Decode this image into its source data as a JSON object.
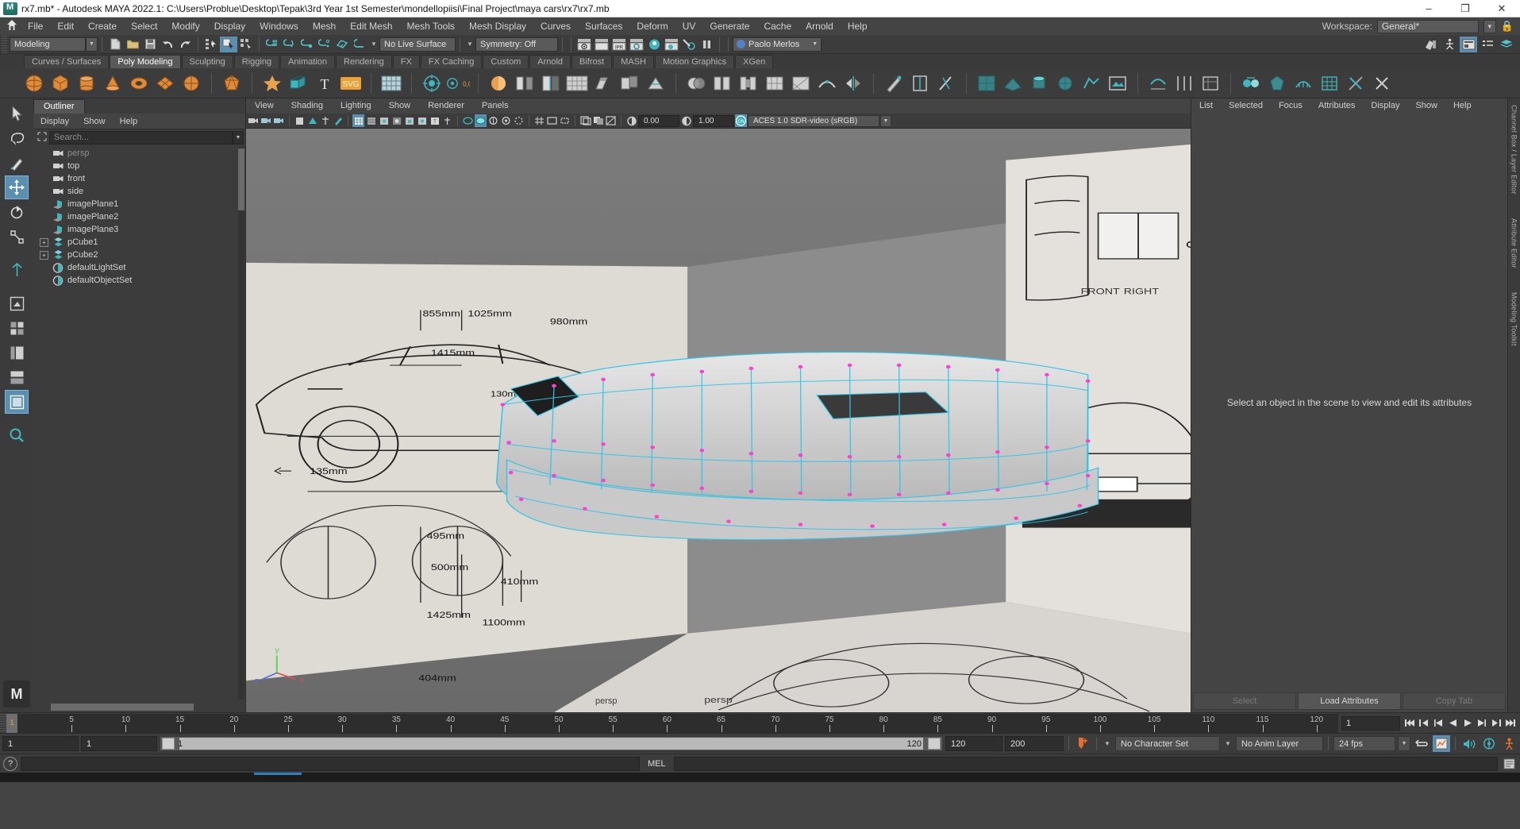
{
  "titlebar": {
    "title": "rx7.mb* - Autodesk MAYA 2022.1: C:\\Users\\Problue\\Desktop\\Tepak\\3rd Year 1st Semester\\mondellopiisi\\Final Project\\maya cars\\rx7\\rx7.mb",
    "minimize": "–",
    "maximize": "❐",
    "close": "✕"
  },
  "menubar": {
    "home_icon": "home-icon",
    "items": [
      "File",
      "Edit",
      "Create",
      "Select",
      "Modify",
      "Display",
      "Windows",
      "Mesh",
      "Edit Mesh",
      "Mesh Tools",
      "Mesh Display",
      "Curves",
      "Surfaces",
      "Deform",
      "UV",
      "Generate",
      "Cache",
      "Arnold",
      "Help"
    ],
    "workspace_label": "Workspace:",
    "workspace_value": "General*"
  },
  "statusbar": {
    "mode": "Modeling",
    "live_surface": "No Live Surface",
    "symmetry": "Symmetry: Off",
    "user": "Paolo Merlos"
  },
  "shelf": {
    "tabs": [
      "Curves / Surfaces",
      "Poly Modeling",
      "Sculpting",
      "Rigging",
      "Animation",
      "Rendering",
      "FX",
      "FX Caching",
      "Custom",
      "Arnold",
      "Bifrost",
      "MASH",
      "Motion Graphics",
      "XGen"
    ],
    "active_tab": "Poly Modeling"
  },
  "outliner": {
    "tab": "Outliner",
    "menu": [
      "Display",
      "Show",
      "Help"
    ],
    "search_placeholder": "Search...",
    "items": [
      {
        "label": "persp",
        "icon": "camera-icon",
        "dim": true,
        "expand": false,
        "indent": 1
      },
      {
        "label": "top",
        "icon": "camera-icon",
        "dim": false,
        "expand": false,
        "indent": 1
      },
      {
        "label": "front",
        "icon": "camera-icon",
        "dim": false,
        "expand": false,
        "indent": 1
      },
      {
        "label": "side",
        "icon": "camera-icon",
        "dim": false,
        "expand": false,
        "indent": 1
      },
      {
        "label": "imagePlane1",
        "icon": "image-plane-icon",
        "dim": false,
        "expand": false,
        "indent": 1
      },
      {
        "label": "imagePlane2",
        "icon": "image-plane-icon",
        "dim": false,
        "expand": false,
        "indent": 1
      },
      {
        "label": "imagePlane3",
        "icon": "image-plane-icon",
        "dim": false,
        "expand": false,
        "indent": 1
      },
      {
        "label": "pCube1",
        "icon": "mesh-icon",
        "dim": false,
        "expand": true,
        "indent": 0
      },
      {
        "label": "pCube2",
        "icon": "mesh-icon",
        "dim": false,
        "expand": true,
        "indent": 0
      },
      {
        "label": "defaultLightSet",
        "icon": "set-icon",
        "dim": false,
        "expand": false,
        "indent": 1
      },
      {
        "label": "defaultObjectSet",
        "icon": "set-icon",
        "dim": false,
        "expand": false,
        "indent": 1
      }
    ]
  },
  "viewport": {
    "menu": [
      "View",
      "Shading",
      "Lighting",
      "Show",
      "Renderer",
      "Panels"
    ],
    "exposure": "0.00",
    "gamma": "1.00",
    "color_profile": "ACES 1.0 SDR-video (sRGB)",
    "camera_label": "persp",
    "axis_labels": {
      "x": "x",
      "y": "y",
      "z": "z"
    },
    "blueprint_dims": [
      "855mm",
      "1025mm",
      "980mm",
      "1415mm",
      "130mm",
      "135mm",
      "495mm",
      "500mm",
      "410mm",
      "1425mm",
      "1100mm",
      "404mm"
    ],
    "front_right_label": {
      "front": "FRONT",
      "right": "RIGHT"
    }
  },
  "attribute_editor": {
    "menu": [
      "List",
      "Selected",
      "Focus",
      "Attributes",
      "Display",
      "Show",
      "Help"
    ],
    "empty_message": "Select an object in the scene to view and edit its attributes",
    "buttons": [
      "Select",
      "Load Attributes",
      "Copy Tab"
    ]
  },
  "right_rail": {
    "labels": [
      "Channel Box / Layer Editor",
      "Attribute Editor",
      "Modeling Toolkit"
    ]
  },
  "timeline": {
    "current_frame": "1",
    "ticks": [
      5,
      10,
      15,
      20,
      25,
      30,
      35,
      40,
      45,
      50,
      55,
      60,
      65,
      70,
      75,
      80,
      85,
      90,
      95,
      100,
      105,
      110,
      115,
      120
    ],
    "frame_field": "1",
    "playback_buttons": [
      "go-to-start-icon",
      "step-back-key-icon",
      "step-back-icon",
      "play-back-icon",
      "play-forward-icon",
      "step-forward-icon",
      "step-forward-key-icon",
      "go-to-end-icon"
    ]
  },
  "rangebar": {
    "start": "1",
    "range_start": "1",
    "slider_left_label": "1",
    "slider_right_label": "120",
    "range_end": "120",
    "end": "200",
    "character_set": "No Character Set",
    "anim_layer": "No Anim Layer",
    "fps": "24 fps",
    "icons": [
      "auto-key-icon",
      "loop-icon",
      "animation-preferences-icon",
      "sound-icon",
      "playblast-icon",
      "character-icon"
    ]
  },
  "command_line": {
    "help_icon": "help-icon",
    "language": "MEL",
    "input_value": "",
    "output_value": ""
  }
}
